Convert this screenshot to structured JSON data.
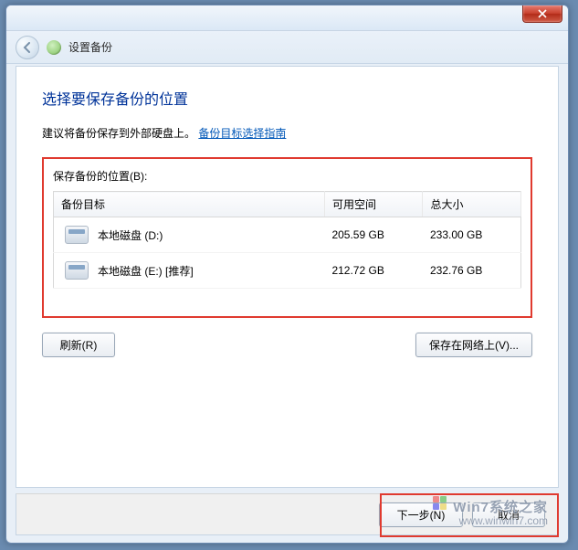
{
  "window": {
    "title": "设置备份"
  },
  "page": {
    "heading": "选择要保存备份的位置",
    "advice_text": "建议将备份保存到外部硬盘上。",
    "advice_link": "备份目标选择指南"
  },
  "locations": {
    "label": "保存备份的位置(B):",
    "columns": {
      "target": "备份目标",
      "free": "可用空间",
      "total": "总大小"
    },
    "rows": [
      {
        "name": "本地磁盘 (D:)",
        "free": "205.59 GB",
        "total": "233.00 GB"
      },
      {
        "name": "本地磁盘 (E:) [推荐]",
        "free": "212.72 GB",
        "total": "232.76 GB"
      }
    ]
  },
  "buttons": {
    "refresh": "刷新(R)",
    "save_network": "保存在网络上(V)...",
    "next": "下一步(N)",
    "cancel": "取消"
  },
  "watermark": {
    "line1": "Win7系统之家",
    "line2": "www.winwin7.com"
  }
}
